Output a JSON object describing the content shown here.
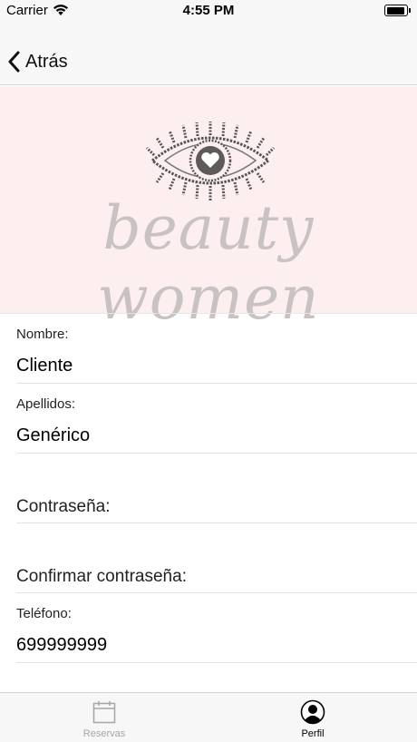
{
  "status_bar": {
    "carrier": "Carrier",
    "time": "4:55 PM",
    "battery_level": 0.95
  },
  "nav": {
    "back_label": "Atrás"
  },
  "banner": {
    "brand_text": "beauty women",
    "background_color": "#fdefef"
  },
  "form": {
    "nombre": {
      "label": "Nombre:",
      "value": "Cliente"
    },
    "apellidos": {
      "label": "Apellidos:",
      "value": "Genérico"
    },
    "contrasena": {
      "placeholder": "Contraseña:"
    },
    "confirmar": {
      "placeholder": "Confirmar contraseña:"
    },
    "telefono": {
      "label": "Teléfono:",
      "value": "699999999"
    }
  },
  "tab_bar": {
    "items": [
      {
        "label": "Reservas",
        "icon": "calendar-icon",
        "selected": false
      },
      {
        "label": "Perfil",
        "icon": "profile-icon",
        "selected": true
      }
    ]
  }
}
